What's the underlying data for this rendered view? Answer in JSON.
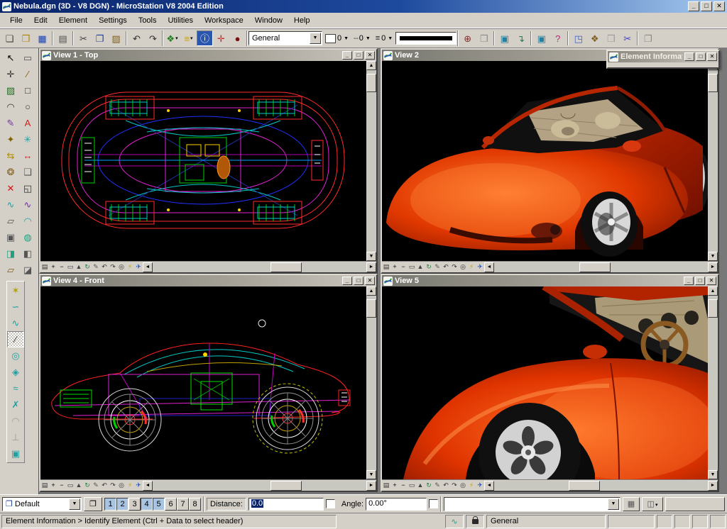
{
  "window": {
    "title": "Nebula.dgn (3D - V8 DGN) - MicroStation V8 2004 Edition"
  },
  "icons": {
    "minimize": "_",
    "maximize": "□",
    "close": "✕",
    "up": "▲",
    "down": "▼",
    "left": "◄",
    "right": "►",
    "dropdown": "▼"
  },
  "menu": {
    "items": [
      "File",
      "Edit",
      "Element",
      "Settings",
      "Tools",
      "Utilities",
      "Workspace",
      "Window",
      "Help"
    ]
  },
  "toolbar": {
    "standard": [
      {
        "name": "new-file-button",
        "glyph": "❏",
        "color": "#404040"
      },
      {
        "name": "open-file-button",
        "glyph": "❒",
        "color": "#b08000"
      },
      {
        "name": "save-button",
        "glyph": "▦",
        "color": "#2040a0"
      },
      {
        "type": "sep"
      },
      {
        "name": "print-button",
        "glyph": "▤",
        "color": "#505050"
      },
      {
        "type": "sep"
      },
      {
        "name": "cut-button",
        "glyph": "✂",
        "color": "#404040"
      },
      {
        "name": "copy-button",
        "glyph": "❐",
        "color": "#2040a0"
      },
      {
        "name": "paste-button",
        "glyph": "▨",
        "color": "#806020"
      },
      {
        "type": "sep"
      },
      {
        "name": "undo-button",
        "glyph": "↶",
        "color": "#303030"
      },
      {
        "name": "redo-button",
        "glyph": "↷",
        "color": "#303030"
      }
    ],
    "primary": [
      {
        "name": "models-button",
        "glyph": "❖",
        "color": "#208020",
        "dropdown": true
      },
      {
        "name": "levels-button",
        "glyph": "≡",
        "color": "#c8a000",
        "dropdown": true
      },
      {
        "name": "element-information-button",
        "glyph": "ⓘ",
        "color": "#ffffff",
        "pressed": true,
        "bg": "#2a56ae"
      },
      {
        "name": "accudraw-button",
        "glyph": "✛",
        "color": "#c83030"
      },
      {
        "name": "raster-manager-button",
        "glyph": "●",
        "color": "#7a1010"
      }
    ],
    "attributes": {
      "active_class": "General",
      "color_value": "0",
      "style_value": "0",
      "weight_value": "0"
    },
    "right_tools": [
      {
        "name": "zoom-tools-button",
        "glyph": "⊕",
        "color": "#803030"
      },
      {
        "name": "view-cube-button",
        "glyph": "❒",
        "color": "#8a8a8a"
      },
      {
        "type": "sep"
      },
      {
        "name": "screen-1-button",
        "glyph": "▣",
        "color": "#2080a0"
      },
      {
        "name": "update-view-button",
        "glyph": "↴",
        "color": "#208060"
      },
      {
        "type": "sep"
      },
      {
        "name": "screen-2-button",
        "glyph": "▣",
        "color": "#2080a0"
      },
      {
        "name": "view-help-button",
        "glyph": "?",
        "color": "#c02080"
      },
      {
        "type": "sep"
      },
      {
        "name": "dialog-with-view-button",
        "glyph": "◳",
        "color": "#4060c0"
      },
      {
        "name": "cel-library-button",
        "glyph": "❖",
        "color": "#806020"
      },
      {
        "name": "render-cube-button",
        "glyph": "❒",
        "color": "#999999"
      },
      {
        "name": "clip-volume-button",
        "glyph": "✂",
        "color": "#4040c0"
      },
      {
        "type": "sep"
      },
      {
        "name": "copy-cube-button",
        "glyph": "❐",
        "color": "#8a8a8a"
      }
    ]
  },
  "palette": {
    "main": [
      {
        "name": "tool-element-selection",
        "glyph": "↖",
        "color": "#000000"
      },
      {
        "name": "tool-fence",
        "glyph": "▭",
        "color": "#555555"
      },
      {
        "name": "tool-points",
        "glyph": "✛",
        "color": "#333333"
      },
      {
        "name": "tool-place-line",
        "glyph": "∕",
        "color": "#806000"
      },
      {
        "name": "tool-patterns",
        "glyph": "▨",
        "color": "#207020"
      },
      {
        "name": "tool-place-shape",
        "glyph": "□",
        "color": "#333333"
      },
      {
        "name": "tool-place-arc",
        "glyph": "◠",
        "color": "#333333"
      },
      {
        "name": "tool-place-ellipse",
        "glyph": "○",
        "color": "#333333"
      },
      {
        "name": "tool-annotate",
        "glyph": "✎",
        "color": "#7030a0"
      },
      {
        "name": "tool-place-text",
        "glyph": "A",
        "color": "#cc2020"
      },
      {
        "name": "tool-tags",
        "glyph": "✦",
        "color": "#806000"
      },
      {
        "name": "tool-xyz-points",
        "glyph": "✳",
        "color": "#20a0a0"
      },
      {
        "name": "tool-dimension-linear",
        "glyph": "⇆",
        "color": "#b09000"
      },
      {
        "name": "tool-dimension-angular",
        "glyph": "↔",
        "color": "#cc2020"
      },
      {
        "name": "tool-change-attributes",
        "glyph": "❂",
        "color": "#806020"
      },
      {
        "name": "tool-drop-element",
        "glyph": "❑",
        "color": "#555555"
      },
      {
        "name": "tool-delete-element",
        "glyph": "✕",
        "color": "#dd1010"
      },
      {
        "name": "tool-measure",
        "glyph": "◱",
        "color": "#333333"
      },
      {
        "name": "tool-bspline-curves",
        "glyph": "∿",
        "color": "#20a0a0"
      },
      {
        "name": "tool-curve-calculator",
        "glyph": "∿",
        "color": "#7030a0"
      },
      {
        "name": "tool-3d-primitives",
        "glyph": "▱",
        "color": "#555555"
      },
      {
        "name": "tool-3d-surfaces",
        "glyph": "◠",
        "color": "#20a0a0"
      },
      {
        "name": "tool-3d-construct",
        "glyph": "▣",
        "color": "#555555"
      },
      {
        "name": "tool-3d-revolve",
        "glyph": "◍",
        "color": "#20a080"
      },
      {
        "name": "tool-3d-modify",
        "glyph": "◨",
        "color": "#20a080"
      },
      {
        "name": "tool-3d-utility",
        "glyph": "◧",
        "color": "#555555"
      },
      {
        "name": "tool-3d-slab",
        "glyph": "▱",
        "color": "#806020"
      },
      {
        "name": "tool-3d-wedge",
        "glyph": "◪",
        "color": "#555555"
      }
    ],
    "sub": [
      {
        "name": "tool-modify-curve",
        "glyph": "✶",
        "color": "#b0a000"
      },
      {
        "name": "tool-place-curve",
        "glyph": "∽",
        "color": "#20a0a0"
      },
      {
        "name": "tool-curve-by-points",
        "glyph": "∿",
        "color": "#20a0a0"
      },
      {
        "name": "tool-active-linear",
        "glyph": "∕",
        "color": "#303030",
        "pressed": true
      },
      {
        "name": "tool-circle-center",
        "glyph": "◎",
        "color": "#20a0a0"
      },
      {
        "name": "tool-diamond",
        "glyph": "◈",
        "color": "#20a0a0"
      },
      {
        "name": "tool-zigzag",
        "glyph": "≈",
        "color": "#20a0a0"
      },
      {
        "name": "tool-cross",
        "glyph": "✗",
        "color": "#20a0a0"
      },
      {
        "name": "tool-arc-disabled",
        "glyph": "◠",
        "color": "#9a9a9a",
        "disabled": true
      },
      {
        "name": "tool-perpendicular-disabled",
        "glyph": "⊥",
        "color": "#9a9a9a",
        "disabled": true
      },
      {
        "name": "tool-rect-points",
        "glyph": "▣",
        "color": "#20a0a0"
      }
    ]
  },
  "views": {
    "v1": {
      "title": "View 1 - Top"
    },
    "v2": {
      "title": "View 2"
    },
    "v4": {
      "title": "View 4 - Front"
    },
    "v5": {
      "title": "View 5"
    }
  },
  "element_info": {
    "title": "Element Information"
  },
  "view_controls": {
    "icons": [
      {
        "name": "view-attributes-icon",
        "glyph": "▤",
        "color": "#333333"
      },
      {
        "name": "zoom-in-icon",
        "glyph": "+",
        "color": "#000000"
      },
      {
        "name": "zoom-out-icon",
        "glyph": "−",
        "color": "#000000"
      },
      {
        "name": "window-area-icon",
        "glyph": "▭",
        "color": "#333333"
      },
      {
        "name": "fit-view-icon",
        "glyph": "▲",
        "color": "#444444"
      },
      {
        "name": "rotate-view-icon",
        "glyph": "↻",
        "color": "#208040"
      },
      {
        "name": "pan-view-icon",
        "glyph": "✎",
        "color": "#555555"
      },
      {
        "name": "view-previous-icon",
        "glyph": "↶",
        "color": "#333333"
      },
      {
        "name": "view-next-icon",
        "glyph": "↷",
        "color": "#333333"
      },
      {
        "name": "copy-view-icon",
        "glyph": "◎",
        "color": "#333333"
      },
      {
        "name": "render-icon",
        "glyph": "⚡",
        "color": "#c0a000"
      },
      {
        "name": "navigate-view-icon",
        "glyph": "✈",
        "color": "#2050c0"
      }
    ]
  },
  "bottom_bar": {
    "view_group_value": "Default",
    "view_toggles": [
      {
        "label": "1",
        "active": true
      },
      {
        "label": "2",
        "active": true
      },
      {
        "label": "3",
        "active": false
      },
      {
        "label": "4",
        "active": true
      },
      {
        "label": "5",
        "active": true
      },
      {
        "label": "6",
        "active": false
      },
      {
        "label": "7",
        "active": false
      },
      {
        "label": "8",
        "active": false
      }
    ],
    "distance_label": "Distance:",
    "distance_value": "0.0",
    "angle_label": "Angle:",
    "angle_value": "0.00°",
    "keyin_value": ""
  },
  "status_bar": {
    "message": "Element Information > Identify Element (Ctrl + Data to select header)",
    "snap_mode_label": "General"
  },
  "colors": {
    "titlebar_start": "#0a246a",
    "titlebar_end": "#a6caf0",
    "chrome": "#d4d0c8",
    "selection": "#0a246a",
    "view_bg": "#000000"
  }
}
